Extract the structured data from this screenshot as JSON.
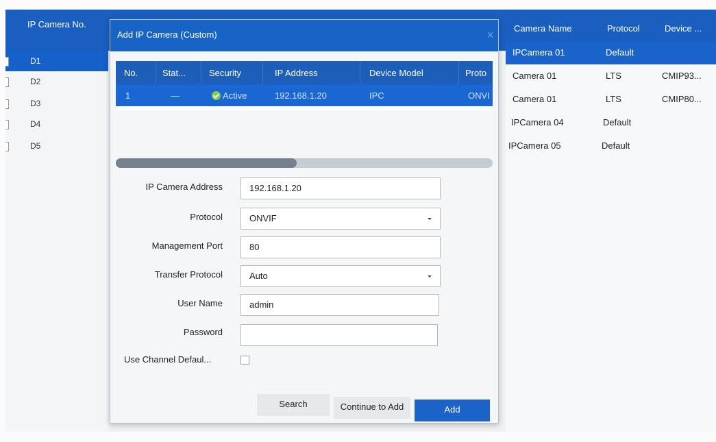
{
  "left_list": {
    "header": "IP Camera No.",
    "items": [
      {
        "label": "D1",
        "selected": true
      },
      {
        "label": "D2",
        "selected": false
      },
      {
        "label": "D3",
        "selected": false
      },
      {
        "label": "D4",
        "selected": false
      },
      {
        "label": "D5",
        "selected": false
      }
    ]
  },
  "right_list": {
    "headers": [
      "Camera Name",
      "Protocol",
      "Device ..."
    ],
    "rows": [
      {
        "name": "IPCamera 01",
        "protocol": "Default",
        "device": "",
        "selected": true
      },
      {
        "name": "Camera 01",
        "protocol": "LTS",
        "device": "CMIP93...",
        "selected": false
      },
      {
        "name": "Camera 01",
        "protocol": "LTS",
        "device": "CMIP80...",
        "selected": false
      },
      {
        "name": "IPCamera 04",
        "protocol": "Default",
        "device": "",
        "selected": false
      },
      {
        "name": "IPCamera 05",
        "protocol": "Default",
        "device": "",
        "selected": false
      }
    ]
  },
  "dialog": {
    "title": "Add IP Camera (Custom)",
    "close_icon": "×",
    "table": {
      "headers": [
        "No.",
        "Stat...",
        "Security",
        "IP Address",
        "Device Model",
        "Proto"
      ],
      "row": {
        "no": "1",
        "status": "—",
        "security": "Active",
        "ip": "192.168.1.20",
        "model": "IPC",
        "protocol": "ONVI"
      }
    },
    "progress": 0.48,
    "form": {
      "ip_address_label": "IP Camera Address",
      "ip_address_value": "192.168.1.20",
      "protocol_label": "Protocol",
      "protocol_value": "ONVIF",
      "port_label": "Management Port",
      "port_value": "80",
      "transfer_label": "Transfer Protocol",
      "transfer_value": "Auto",
      "user_label": "User Name",
      "user_value": "admin",
      "password_label": "Password",
      "password_value": "",
      "default_label": "Use Channel Defaul..."
    },
    "buttons": {
      "search": "Search",
      "continue": "Continue to Add",
      "add": "Add"
    }
  },
  "colors": {
    "accent": "#1a5fbf",
    "selected_row": "#1560c9",
    "status_ok": "#7fcf4a"
  }
}
